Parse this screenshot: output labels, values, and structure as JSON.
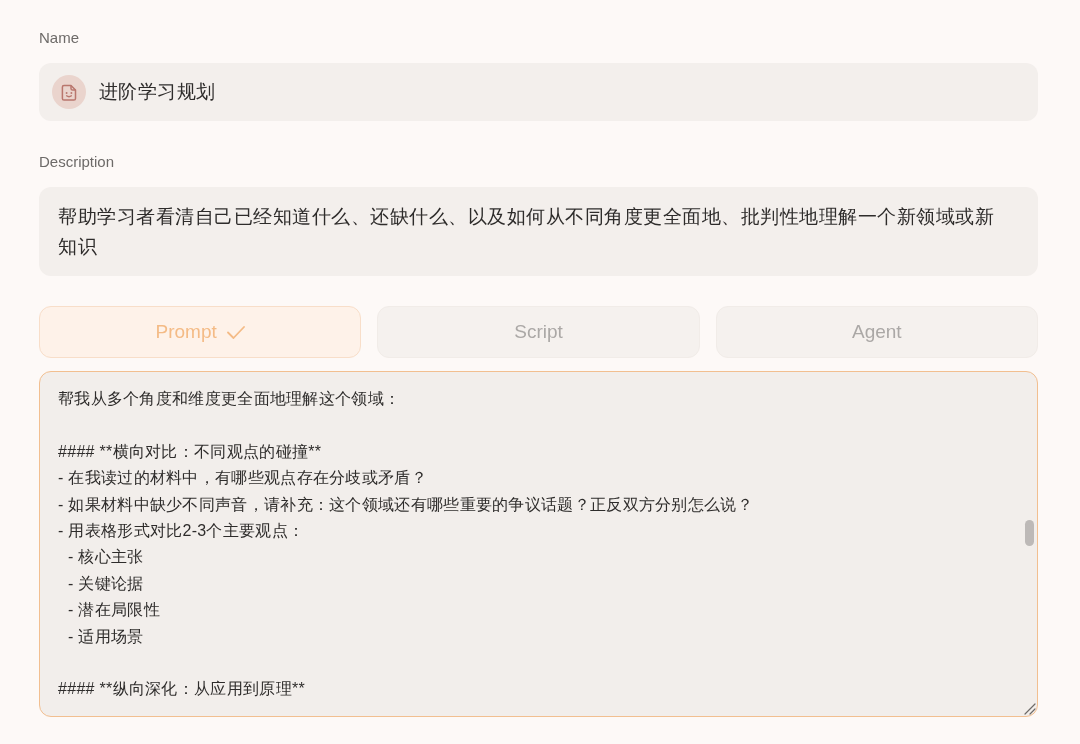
{
  "name_field": {
    "label": "Name",
    "value": "进阶学习规划"
  },
  "description_field": {
    "label": "Description",
    "value": "帮助学习者看清自己已经知道什么、还缺什么、以及如何从不同角度更全面地、批判性地理解一个新领域或新知识"
  },
  "tabs": [
    {
      "label": "Prompt",
      "selected": true
    },
    {
      "label": "Script",
      "selected": false
    },
    {
      "label": "Agent",
      "selected": false
    }
  ],
  "prompt_editor": {
    "blocks": [
      {
        "kind": "paragraph",
        "text": "帮我从多个角度和维度更全面地理解这个领域："
      },
      {
        "kind": "section",
        "heading": "#### **横向对比：不同观点的碰撞**",
        "items": [
          {
            "text": "- 在我读过的材料中，有哪些观点存在分歧或矛盾？"
          },
          {
            "text": "- 如果材料中缺少不同声音，请补充：这个领域还有哪些重要的争议话题？正反双方分别怎么说？"
          },
          {
            "text": "- 用表格形式对比2-3个主要观点：",
            "children": [
              {
                "text": "- 核心主张"
              },
              {
                "text": "- 关键论据"
              },
              {
                "text": "- 潜在局限性"
              },
              {
                "text": "- 适用场景"
              }
            ]
          }
        ]
      },
      {
        "kind": "section",
        "heading": "#### **纵向深化：从应用到原理**"
      }
    ]
  }
}
